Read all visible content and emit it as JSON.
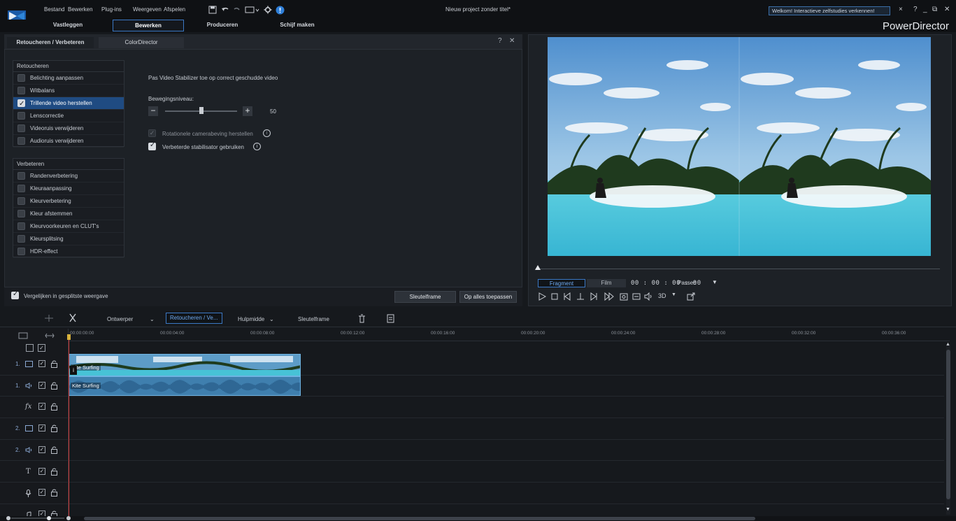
{
  "menu": {
    "items": [
      "Bestand",
      "Bewerken",
      "Plug-ins",
      "Weergeven",
      "Afspelen"
    ],
    "project_title": "Nieuw project zonder titel*",
    "welcome": "Welkom! Interactieve zelfstudies verkennen!",
    "help": "?"
  },
  "modes": {
    "tabs": [
      "Vastleggen",
      "Bewerken",
      "Produceren",
      "Schijf maken"
    ],
    "active": "Bewerken",
    "brand": "PowerDirector"
  },
  "panel": {
    "tabs": [
      "Retoucheren / Verbeteren",
      "ColorDirector"
    ],
    "help": "?",
    "retouch_group": {
      "title": "Retoucheren",
      "items": [
        {
          "label": "Belichting aanpassen",
          "checked": false
        },
        {
          "label": "Witbalans",
          "checked": false
        },
        {
          "label": "Trillende video herstellen",
          "checked": true,
          "selected": true
        },
        {
          "label": "Lenscorrectie",
          "checked": false
        },
        {
          "label": "Videoruis verwijderen",
          "checked": false
        },
        {
          "label": "Audioruis verwijderen",
          "checked": false
        }
      ]
    },
    "enhance_group": {
      "title": "Verbeteren",
      "items": [
        {
          "label": "Randenverbetering",
          "checked": false
        },
        {
          "label": "Kleuraanpassing",
          "checked": false
        },
        {
          "label": "Kleurverbetering",
          "checked": false
        },
        {
          "label": "Kleur afstemmen",
          "checked": false
        },
        {
          "label": "Kleurvoorkeuren en CLUT's",
          "checked": false
        },
        {
          "label": "Kleursplitsing",
          "checked": false
        },
        {
          "label": "HDR-effect",
          "checked": false
        }
      ]
    },
    "stabilizer": {
      "description": "Pas Video Stabilizer toe op correct geschudde video",
      "motion_label": "Bewegingsniveau:",
      "motion_value": "50",
      "motion_fraction": 0.5,
      "rotational_label": "Rotationele camerabeving herstellen",
      "rotational_checked": true,
      "rotational_enabled": false,
      "enhanced_label": "Verbeterde stabilisator gebruiken",
      "enhanced_checked": true
    },
    "footer": {
      "compare_label": "Vergelijken in gesplitste weergave",
      "compare_checked": true,
      "keyframe_button": "Sleutelframe",
      "apply_all_button": "Op alles toepassen"
    }
  },
  "preview": {
    "tab_fragment": "Fragment",
    "tab_film": "Film",
    "timecode": "00 : 00 : 00 : 00",
    "fit": "Passen",
    "mode_3d": "3D"
  },
  "timeline_toolbar": {
    "designer": "Ontwerper",
    "retouch": "Retoucheren / Ve...",
    "tools": "Hulpmidde",
    "keyframe": "Sleutelframe"
  },
  "timeline": {
    "timecodes": [
      "00:00:00:00",
      "00:00:04:00",
      "00:00:08:00",
      "00:00:12:00",
      "00:00:16:00",
      "00:00:20:00",
      "00:00:24:00",
      "00:00:28:00",
      "00:00:32:00",
      "00:00:36:00"
    ],
    "tracks": [
      {
        "num": "1.",
        "kind": "video"
      },
      {
        "num": "1.",
        "kind": "audio"
      },
      {
        "num": "",
        "kind": "fx"
      },
      {
        "num": "2.",
        "kind": "video"
      },
      {
        "num": "2.",
        "kind": "audio"
      },
      {
        "num": "",
        "kind": "title"
      },
      {
        "num": "",
        "kind": "voice"
      },
      {
        "num": "",
        "kind": "music"
      }
    ],
    "fx_label": "fx",
    "title_label": "T",
    "clip_video_label": "Kite Surfing",
    "clip_audio_label": "Kite Surfing",
    "clip_marker": "i"
  },
  "colors": {
    "accent": "#3b78c4",
    "selected_row": "#1f4b82",
    "playhead": "#d13c3c",
    "clip": "#4a8cba"
  }
}
